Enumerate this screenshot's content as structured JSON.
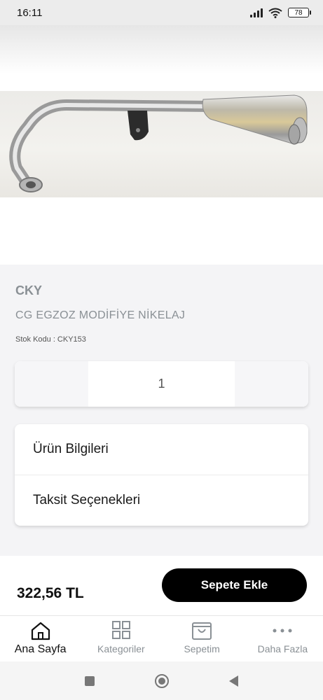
{
  "status_bar": {
    "time": "16:11",
    "battery": "78"
  },
  "product": {
    "brand": "CKY",
    "name": "CG EGZOZ MODİFİYE NİKELAJ",
    "sku": "Stok Kodu : CKY153",
    "image_icon": "exhaust-pipe-photo"
  },
  "quantity": {
    "value": "1"
  },
  "info": {
    "product_info": "Ürün Bilgileri",
    "installments": "Taksit Seçenekleri"
  },
  "purchase": {
    "price": "322,56 TL",
    "add_to_cart": "Sepete Ekle"
  },
  "nav": {
    "home": "Ana Sayfa",
    "categories": "Kategoriler",
    "cart": "Sepetim",
    "more": "Daha Fazla"
  }
}
